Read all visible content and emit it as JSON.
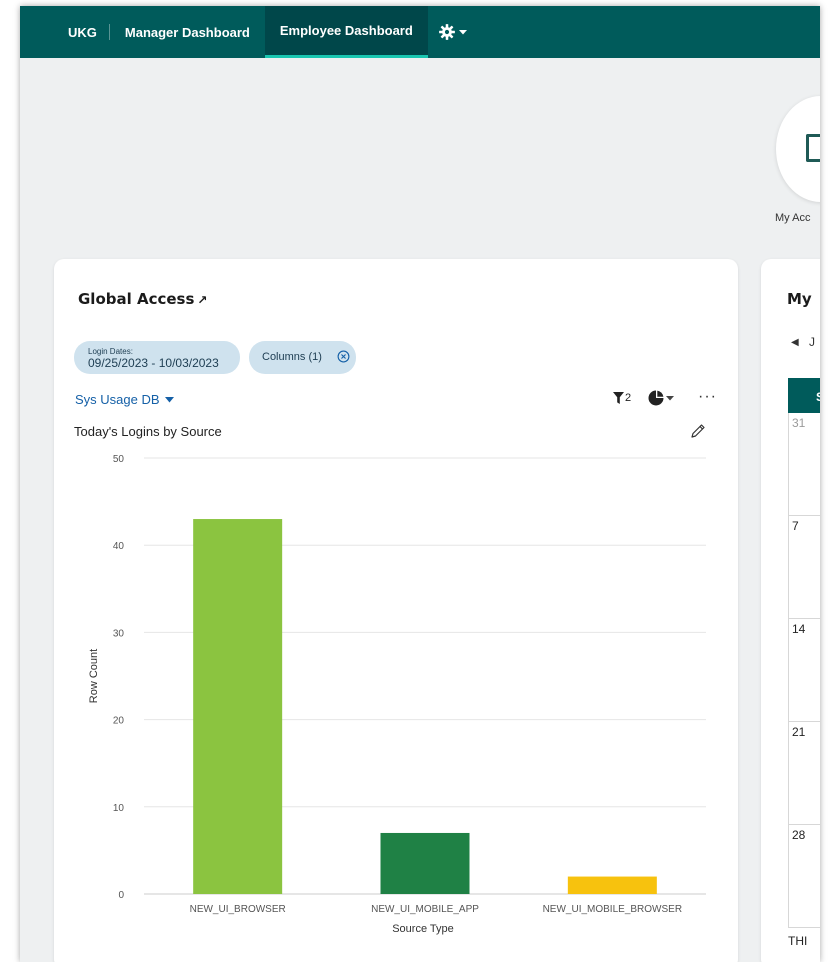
{
  "nav": {
    "brand": "UKG",
    "tabs": [
      {
        "label": "Manager Dashboard",
        "active": false
      },
      {
        "label": "Employee Dashboard",
        "active": true
      }
    ],
    "settings_icon": "gear-icon"
  },
  "quick_tile": {
    "label": "My Acc"
  },
  "global_access": {
    "title": "Global Access",
    "title_icon": "↗",
    "chips": {
      "dates_label": "Login Dates:",
      "dates_value": "09/25/2023 - 10/03/2023",
      "columns_label": "Columns (1)"
    },
    "data_source": "Sys Usage DB",
    "filter_count": "2",
    "more_label": "···",
    "chart_title": "Today's Logins by Source"
  },
  "colors": {
    "nav_bg": "#005b5b",
    "nav_active_underline": "#19c6b0",
    "chip_bg": "#cfe2ee",
    "link_blue": "#1560a7"
  },
  "chart_data": {
    "type": "bar",
    "title": "Today's Logins by Source",
    "xlabel": "Source Type",
    "ylabel": "Row Count",
    "ylim": [
      0,
      50
    ],
    "yticks": [
      0,
      10,
      20,
      30,
      40,
      50
    ],
    "categories": [
      "NEW_UI_BROWSER",
      "NEW_UI_MOBILE_APP",
      "NEW_UI_MOBILE_BROWSER"
    ],
    "values": [
      43,
      7,
      2
    ],
    "bar_colors": [
      "#8bc440",
      "#1f8145",
      "#f7c20e"
    ],
    "grid": true
  },
  "my_card": {
    "title": "My",
    "month_initial": "J",
    "weekday_initial": "S",
    "day_numbers": [
      "31",
      "7",
      "14",
      "21",
      "28"
    ],
    "footer_text": "THI"
  }
}
